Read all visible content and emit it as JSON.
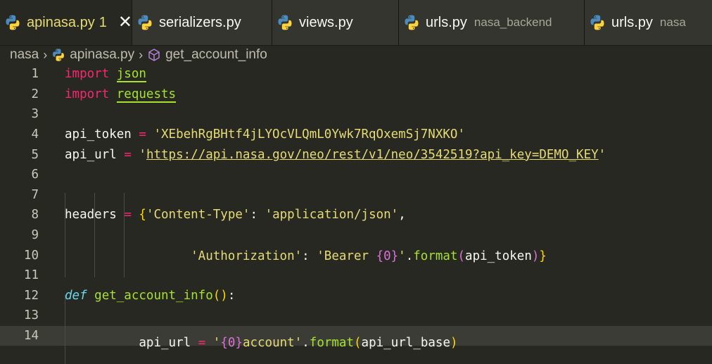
{
  "tabs": [
    {
      "label": "apinasa.py",
      "badge": "1",
      "active": true,
      "close": "✕"
    },
    {
      "label": "serializers.py"
    },
    {
      "label": "views.py"
    },
    {
      "label": "urls.py",
      "desc": "nasa_backend"
    },
    {
      "label": "urls.py",
      "desc": "nasa"
    }
  ],
  "breadcrumb": {
    "folder": "nasa",
    "file": "apinasa.py",
    "symbol": "get_account_info"
  },
  "lines": {
    "l1": {
      "kw": "import",
      "mod": "json"
    },
    "l2": {
      "kw": "import",
      "mod": "requests"
    },
    "l4": {
      "var": "api_token",
      "op": "=",
      "str": "'XEbehRgBHtf4jLYOcVLQmL0Ywk7RqOxemSj7NXKO'"
    },
    "l5": {
      "var": "api_url",
      "op": "=",
      "q1": "'",
      "url": "https://api.nasa.gov/neo/rest/v1/neo/3542519?api_key=DEMO_KEY",
      "q2": "'"
    },
    "l8": {
      "var": "headers",
      "op": "=",
      "brace": "{",
      "k": "'Content-Type'",
      "colon": ":",
      "v": "'application/json'",
      "comma": ","
    },
    "l9": {
      "k": "'Authorization'",
      "colon": ":",
      "s1": "'Bearer ",
      "fmt": "{0}",
      "s2": "'",
      "dot": ".",
      "fn": "format",
      "p1": "(",
      "arg": "api_token",
      "p2": ")",
      "brace": "}"
    },
    "l12": {
      "kw": "def",
      "fn": "get_account_info",
      "p": "()",
      "colon": ":"
    },
    "l14": {
      "var": "api_url",
      "op": "=",
      "s1": "'",
      "fmt": "{0}",
      "s2": "account'",
      "dot": ".",
      "fn": "format",
      "p1": "(",
      "arg": "api_url_base",
      "p2": ")"
    }
  },
  "line_numbers": [
    "1",
    "2",
    "3",
    "4",
    "5",
    "6",
    "7",
    "8",
    "9",
    "10",
    "11",
    "12",
    "13",
    "14"
  ],
  "colors": {
    "background": "#272822",
    "keyword": "#f92672",
    "string": "#e6db74",
    "function": "#a6e22e",
    "def": "#66d9ef"
  }
}
